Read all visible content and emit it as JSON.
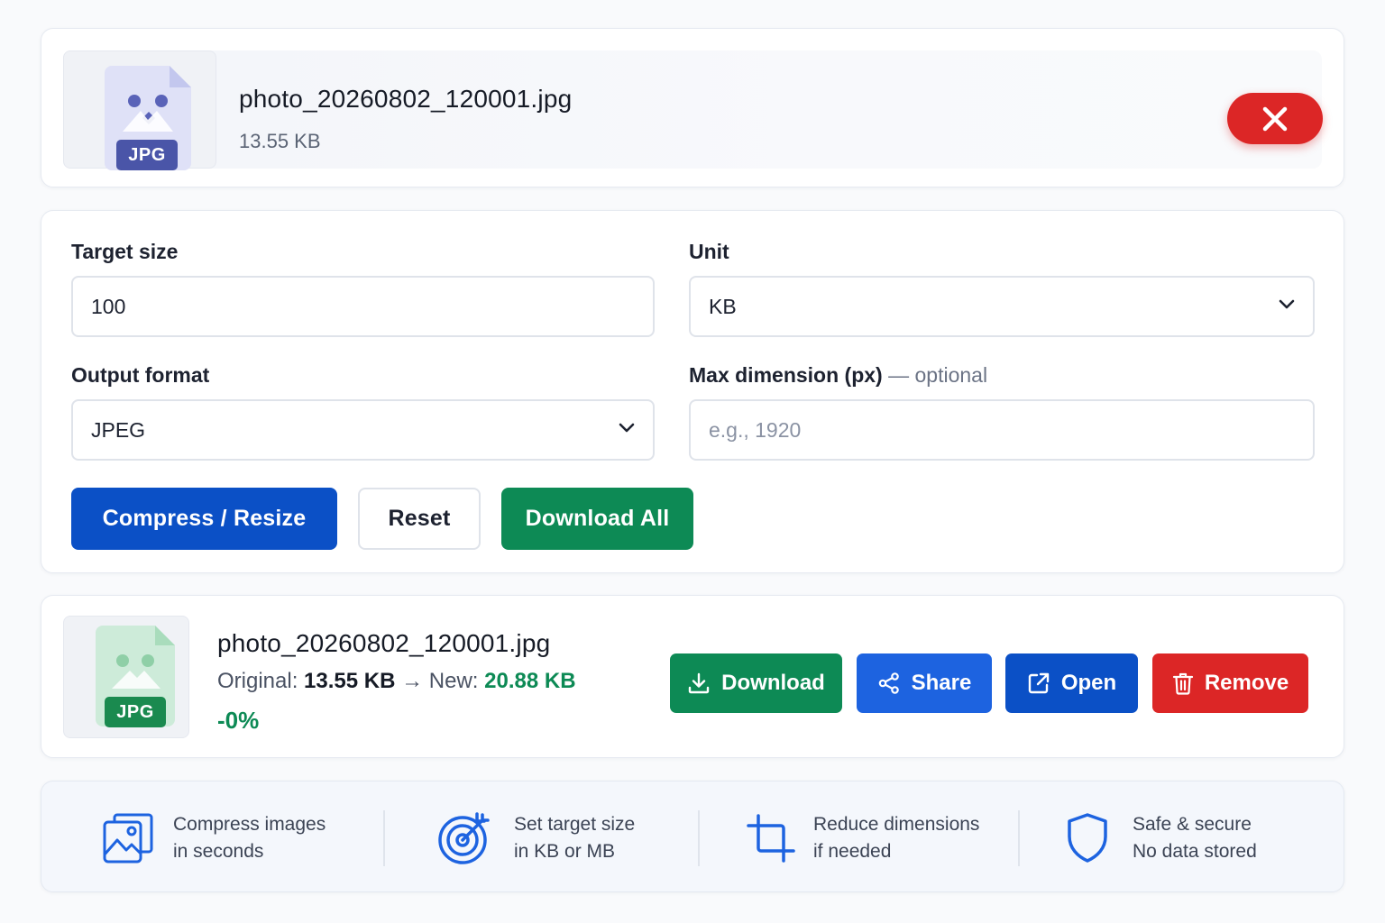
{
  "uploaded_file": {
    "name": "photo_20260802_120001.jpg",
    "size": "13.55 KB",
    "badge": "JPG"
  },
  "form": {
    "target_size_label": "Target size",
    "target_size_value": "100",
    "unit_label": "Unit",
    "unit_value": "KB",
    "output_format_label": "Output format",
    "output_format_value": "JPEG",
    "max_dimension_label": "Max dimension (px)",
    "max_dimension_hint": "— optional",
    "max_dimension_placeholder": "e.g., 1920",
    "compress_label": "Compress / Resize",
    "reset_label": "Reset",
    "download_all_label": "Download All"
  },
  "result": {
    "name": "photo_20260802_120001.jpg",
    "badge": "JPG",
    "original_label": "Original:",
    "original_size": "13.55 KB",
    "arrow": "→",
    "new_label": "New:",
    "new_size": "20.88 KB",
    "saving": "-0%",
    "download_label": "Download",
    "share_label": "Share",
    "open_label": "Open",
    "remove_label": "Remove"
  },
  "features": [
    {
      "icon": "image-icon",
      "line1": "Compress images",
      "line2": "in seconds"
    },
    {
      "icon": "target-icon",
      "line1": "Set target size",
      "line2": "in KB or MB"
    },
    {
      "icon": "crop-icon",
      "line1": "Reduce dimensions",
      "line2": "if needed"
    },
    {
      "icon": "shield-icon",
      "line1": "Safe & secure",
      "line2": "No data stored"
    }
  ],
  "colors": {
    "primary": "#0b50c6",
    "blue": "#1d63e0",
    "green": "#0d8a55",
    "red": "#dc2626",
    "file_icon_purple": "#5a63b8",
    "file_icon_green": "#1a8a4f"
  }
}
